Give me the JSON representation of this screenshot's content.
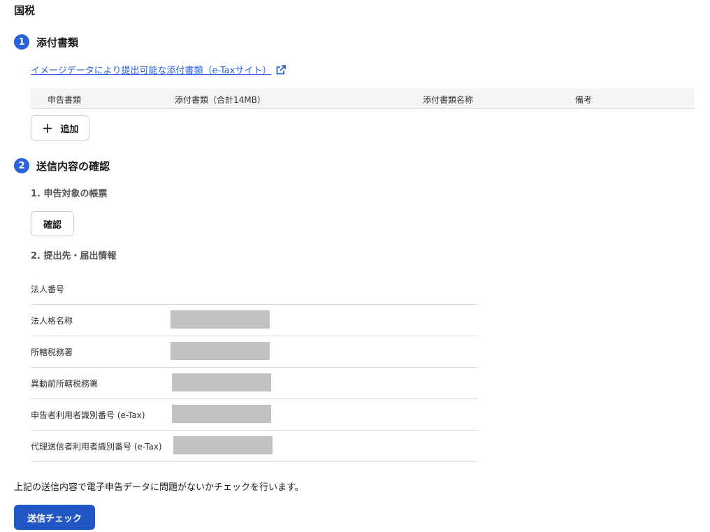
{
  "page": {
    "title": "国税"
  },
  "step1": {
    "number": "1",
    "title": "添付書類",
    "link_text": "イメージデータにより提出可能な添付書類（e-Taxサイト）",
    "table_headers": [
      "申告書類",
      "添付書類（合計14MB）",
      "添付書類名称",
      "備考"
    ],
    "add_button": "追加"
  },
  "step2": {
    "number": "2",
    "title": "送信内容の確認",
    "sub1": "1. 申告対象の帳票",
    "confirm_button": "確認",
    "sub2": "2. 提出先・届出情報",
    "info_rows": [
      {
        "label": "法人番号",
        "redacted": false
      },
      {
        "label": "法人格名称",
        "redacted": true
      },
      {
        "label": "所轄税務署",
        "redacted": true
      },
      {
        "label": "異動前所轄税務署",
        "redacted": true
      },
      {
        "label": "申告者利用者識別番号 (e-Tax)",
        "redacted": true
      },
      {
        "label": "代理送信者利用者識別番号 (e-Tax)",
        "redacted": true
      }
    ]
  },
  "footer": {
    "notice": "上記の送信内容で電子申告データに問題がないかチェックを行います。",
    "send_check_button": "送信チェック"
  },
  "colors": {
    "accent": "#2962d9",
    "primary_button": "#2257c6",
    "redaction": "#c2c2c2"
  }
}
